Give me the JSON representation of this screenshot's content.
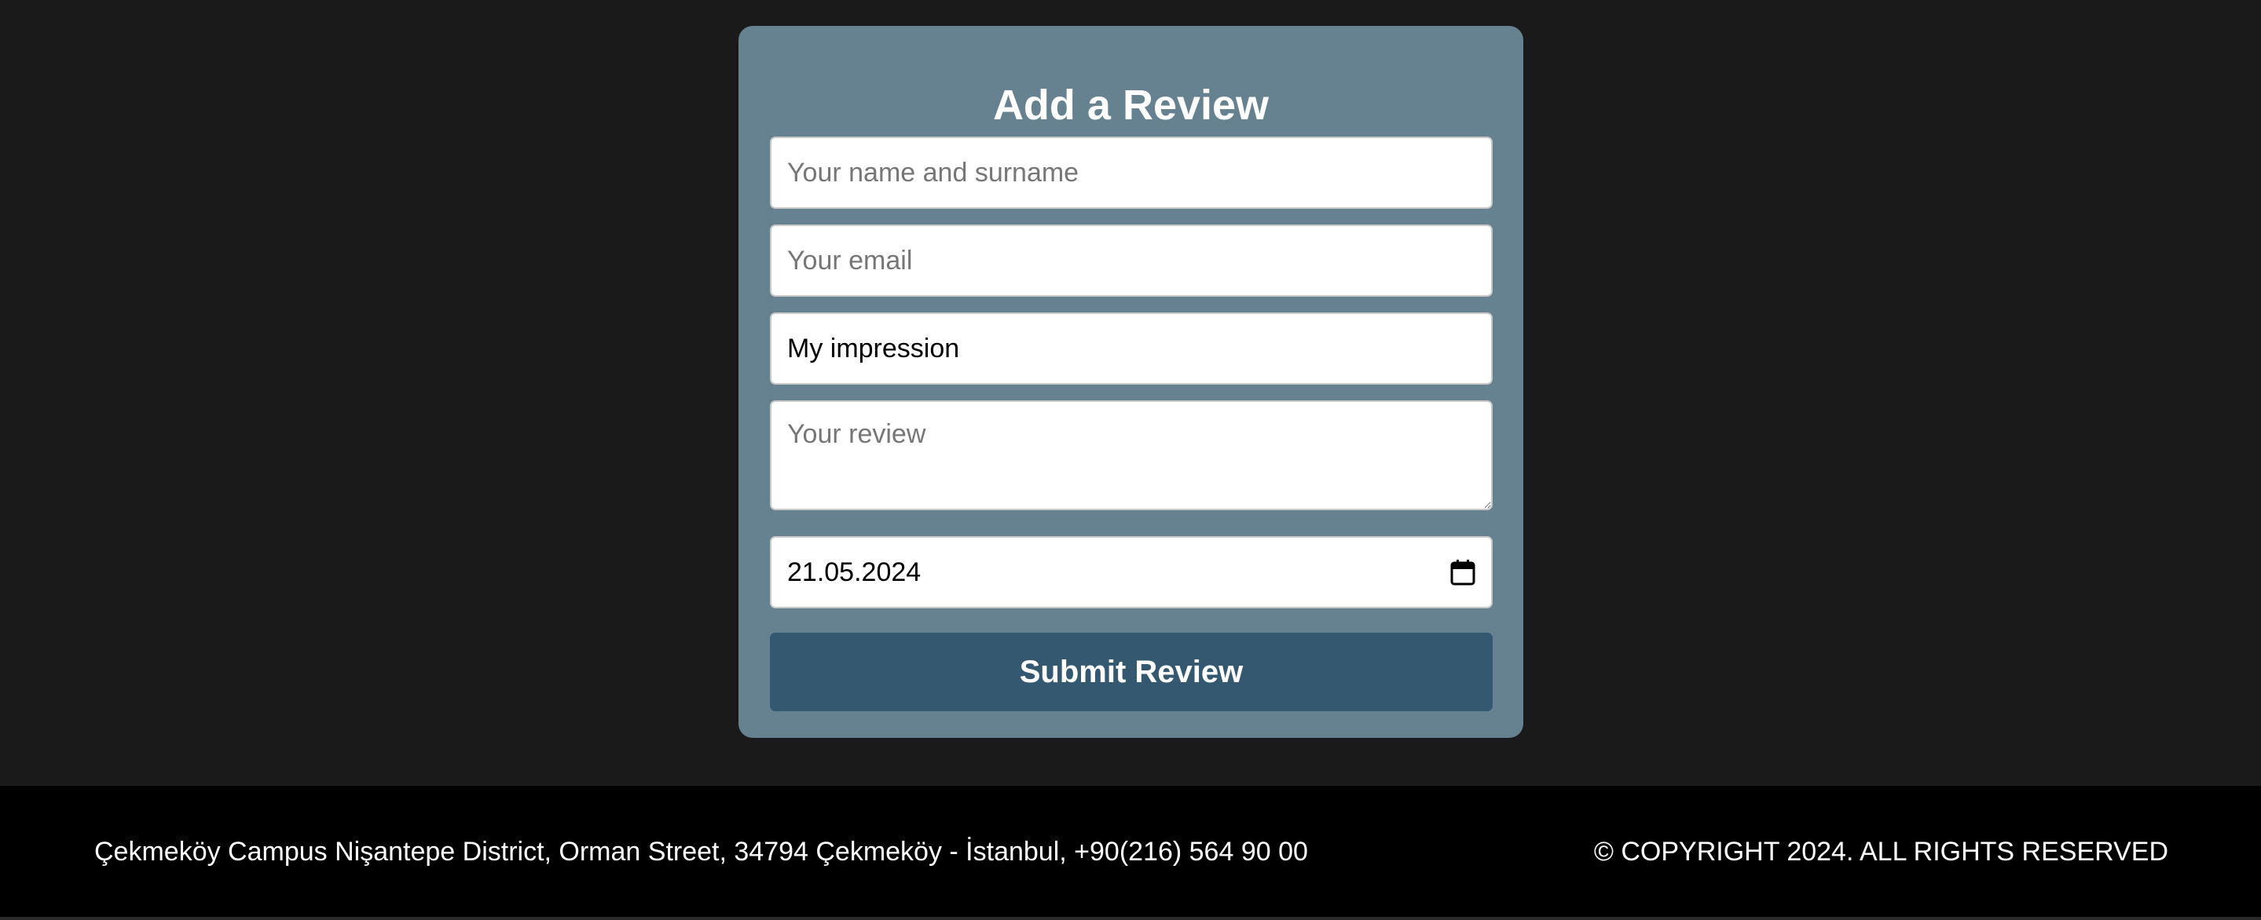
{
  "review_form": {
    "title": "Add a Review",
    "name_placeholder": "Your name and surname",
    "email_placeholder": "Your email",
    "impression_value": "My impression",
    "review_placeholder": "Your review",
    "date_value": "21.05.2024",
    "submit_label": "Submit Review"
  },
  "footer": {
    "address": "Çekmeköy Campus Nişantepe District, Orman Street, 34794 Çekmeköy - İstanbul, +90(216) 564 90 00",
    "copyright": "© COPYRIGHT 2024. ALL RIGHTS RESERVED"
  },
  "icons": {
    "date_picker": "calendar-icon"
  },
  "colors": {
    "page_background": "#1a1a1a",
    "card_background": "#668291",
    "button_background": "#33586f",
    "footer_background": "#000000"
  }
}
